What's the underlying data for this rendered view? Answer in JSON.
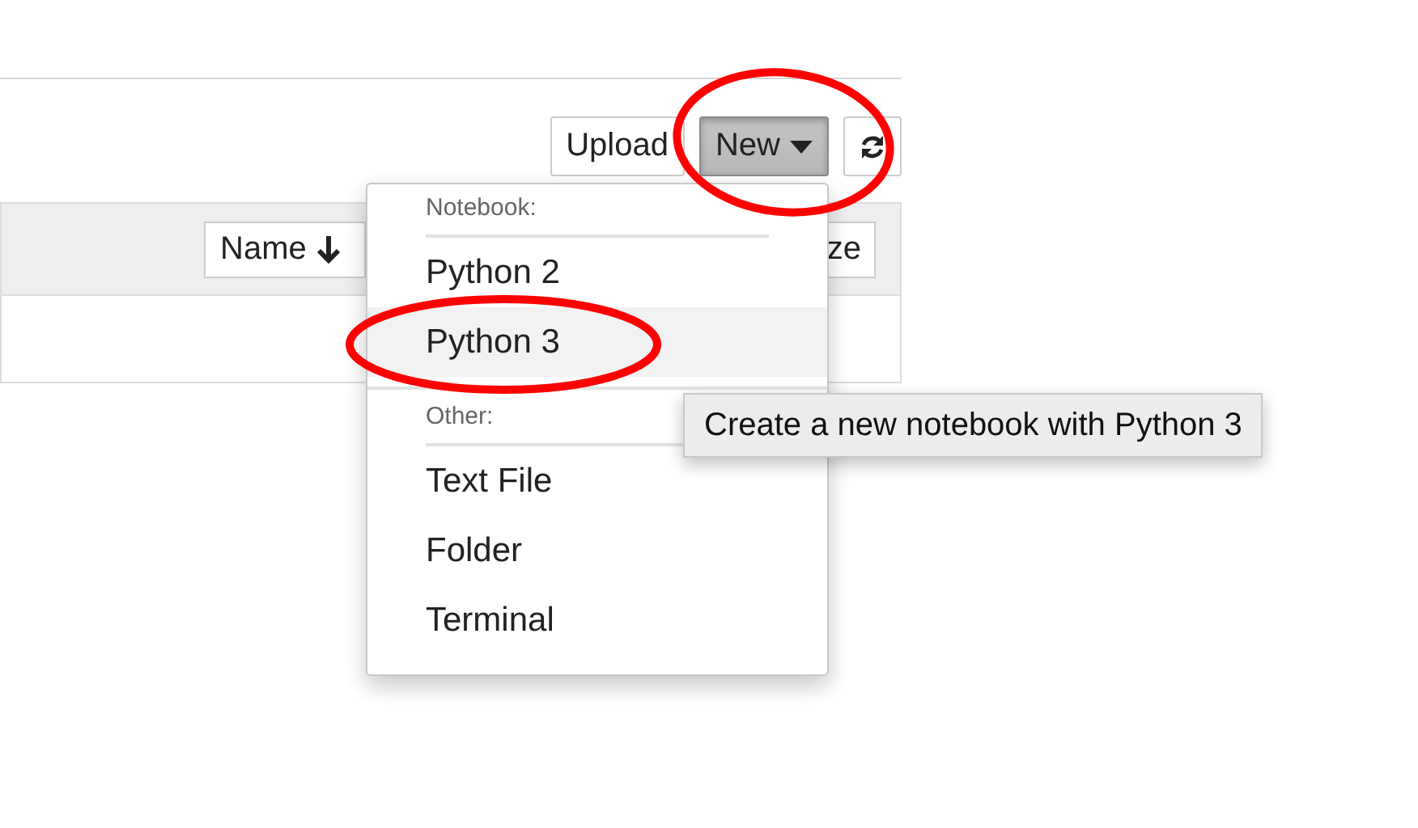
{
  "toolbar": {
    "buttons": [
      {
        "label": "Upload",
        "kind": "text",
        "pressed": false
      },
      {
        "label": "New",
        "kind": "dropdown",
        "pressed": true
      },
      {
        "kind": "refresh",
        "pressed": false
      }
    ]
  },
  "file_list": {
    "sort_button": {
      "label": "Name"
    },
    "column_2": "ze"
  },
  "new_menu": {
    "sections": [
      {
        "header": "Notebook:",
        "items": [
          {
            "label": "Python 2",
            "selected": false
          },
          {
            "label": "Python 3",
            "selected": true
          }
        ]
      },
      {
        "header": "Other:",
        "items": [
          {
            "label": "Text File",
            "selected": false
          },
          {
            "label": "Folder",
            "selected": false
          },
          {
            "label": "Terminal",
            "selected": false
          }
        ]
      }
    ]
  },
  "tooltip": {
    "text": "Create a new notebook with Python 3"
  }
}
